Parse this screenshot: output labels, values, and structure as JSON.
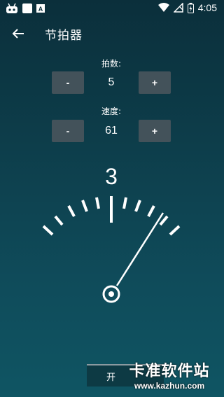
{
  "status_bar": {
    "time": "4:05",
    "left_icons": [
      "android-icon",
      "square-icon",
      "a-icon"
    ],
    "right_icons": [
      "wifi-icon",
      "no-signal-icon",
      "battery-icon"
    ]
  },
  "app_bar": {
    "title": "节拍器"
  },
  "beats": {
    "label": "拍数:",
    "minus": "-",
    "plus": "+",
    "value": "5"
  },
  "tempo": {
    "label": "速度:",
    "minus": "-",
    "plus": "+",
    "value": "61"
  },
  "metronome": {
    "current_beat": "3",
    "needle_icon": "pendulum-needle",
    "pivot_icon": "pivot-circle-icon"
  },
  "start_button": {
    "label": "开"
  },
  "watermark": {
    "title": "卡准软件站",
    "url": "www.kazhun.com"
  },
  "colors": {
    "background_top": "#0b2f3b",
    "background_bottom": "#0f5563",
    "button": "#43525a"
  }
}
